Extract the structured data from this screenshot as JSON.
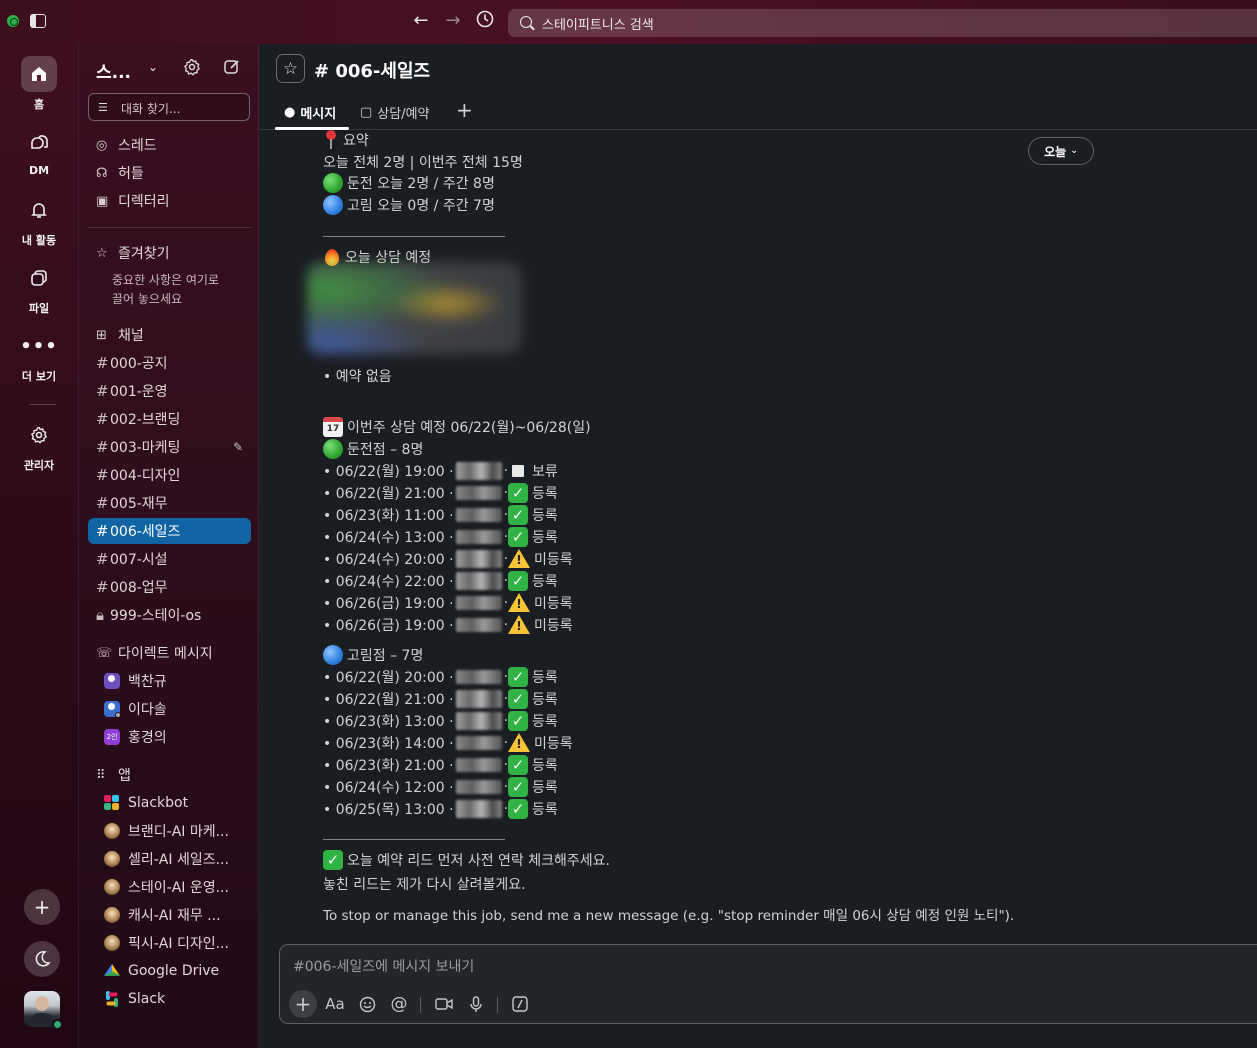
{
  "titlebar": {
    "search_placeholder": "스테이피트니스 검색",
    "back": "←",
    "forward": "→",
    "history": "⏱"
  },
  "rail": {
    "home": "홈",
    "dm": "DM",
    "activity": "내 활동",
    "files": "파일",
    "more": "더 보기",
    "admin": "관리자"
  },
  "sidebar": {
    "workspace": "스...",
    "find_placeholder": "대화 찾기...",
    "top_items": [
      "스레드",
      "허들",
      "디렉터리"
    ],
    "favorites_header": "즐겨찾기",
    "favorites_note_1": "중요한 사항은 여기로",
    "favorites_note_2": "끌어 놓으세요",
    "channels_header": "채널",
    "channels": [
      "000-공지",
      "001-운영",
      "002-브랜딩",
      "003-마케팅",
      "004-디자인",
      "005-재무",
      "006-세일즈",
      "007-시설",
      "008-업무",
      "999-스테이-os"
    ],
    "dm_header": "다이렉트 메시지",
    "dms": [
      "백찬규",
      "이다솔",
      "홍경의"
    ],
    "apps_header": "앱",
    "apps": [
      "Slackbot",
      "브랜디-AI 마케...",
      "셀리-AI 세일즈...",
      "스테이-AI 운영...",
      "캐시-AI 재무 ...",
      "픽시-AI 디자인...",
      "Google Drive",
      "Slack"
    ]
  },
  "channel": {
    "title": "# 006-세일즈",
    "tabs": [
      "메시지",
      "상담/예약"
    ],
    "date_pill": "오늘"
  },
  "message": {
    "summary_title": "요약",
    "summary_line": "오늘 전체 2명 | 이번주 전체 15명",
    "summary_dunjeon": "둔전 오늘 2명 / 주간 8명",
    "summary_gorim": "고림 오늘 0명 / 주간 7명",
    "today_title": "오늘 상담 예정",
    "no_reservation": "• 예약 없음",
    "week_title": "이번주 상담 예정 06/22(월)~06/28(일)",
    "dunjeon_header": "둔전점 – 8명",
    "dunjeon_rows": [
      {
        "time": "• 06/22(월) 19:00 ·",
        "status": "보류",
        "kind": "hold"
      },
      {
        "time": "• 06/22(월) 21:00 ·",
        "status": "등록",
        "kind": "ok"
      },
      {
        "time": "• 06/23(화) 11:00 ·",
        "status": "등록",
        "kind": "ok"
      },
      {
        "time": "• 06/24(수) 13:00 ·",
        "status": "등록",
        "kind": "ok"
      },
      {
        "time": "• 06/24(수) 20:00 ·",
        "status": "미등록",
        "kind": "warn"
      },
      {
        "time": "• 06/24(수) 22:00 ·",
        "status": "등록",
        "kind": "ok"
      },
      {
        "time": "• 06/26(금) 19:00 ·",
        "status": "미등록",
        "kind": "warn"
      },
      {
        "time": "• 06/26(금) 19:00 ·",
        "status": "미등록",
        "kind": "warn"
      }
    ],
    "gorim_header": "고림점 – 7명",
    "gorim_rows": [
      {
        "time": "• 06/22(월) 20:00 ·",
        "status": "등록",
        "kind": "ok"
      },
      {
        "time": "• 06/22(월) 21:00 ·",
        "status": "등록",
        "kind": "ok"
      },
      {
        "time": "• 06/23(화) 13:00 ·",
        "status": "등록",
        "kind": "ok"
      },
      {
        "time": "• 06/23(화) 14:00 ·",
        "status": "미등록",
        "kind": "warn"
      },
      {
        "time": "• 06/23(화) 21:00 ·",
        "status": "등록",
        "kind": "ok"
      },
      {
        "time": "• 06/24(수) 12:00 ·",
        "status": "등록",
        "kind": "ok"
      },
      {
        "time": "• 06/25(목) 13:00 ·",
        "status": "등록",
        "kind": "ok"
      }
    ],
    "closing_1": "오늘 예약 리드 먼저 사전 연락 체크해주세요.",
    "closing_2": "놓친 리드는 제가 다시 살려볼게요.",
    "footer": "To stop or manage this job, send me a new message (e.g. \"stop reminder 매일 06시 상담 예정 인원 노티\")."
  },
  "composer": {
    "placeholder": "#006-세일즈에 메시지 보내기"
  },
  "colors": {
    "accent": "#1164a3",
    "sidebar": "#3a0f20",
    "success": "#2fb344",
    "warning": "#f7c436"
  }
}
